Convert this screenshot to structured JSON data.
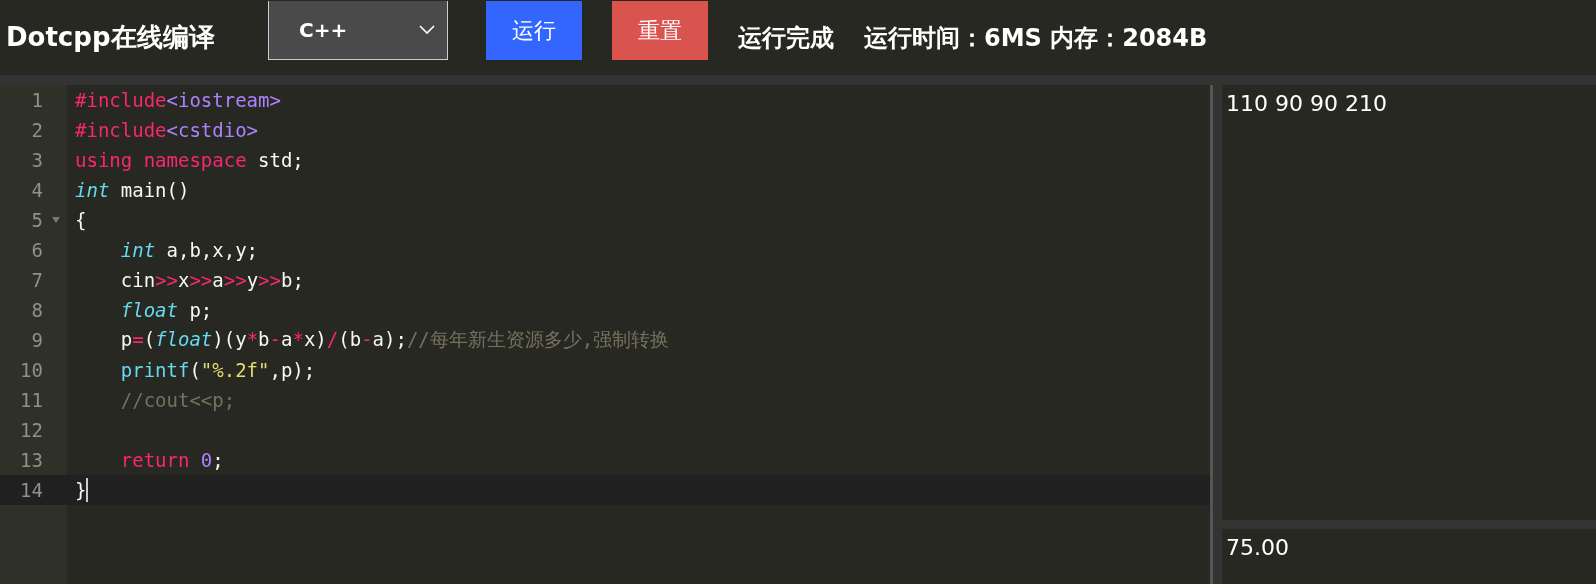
{
  "header": {
    "title": "Dotcpp在线编译",
    "language": "C++",
    "buttons": [
      {
        "kind": "run",
        "label": "运行"
      },
      {
        "kind": "reset",
        "label": "重置"
      }
    ],
    "status": "运行完成",
    "stats": "运行时间：6MS 内存：2084B"
  },
  "editor": {
    "lines": [
      {
        "number": "1",
        "active": false,
        "foldable": false,
        "tokens": [
          {
            "kind": "keyword",
            "text": "#include"
          },
          {
            "kind": "number",
            "text": "<iostream>"
          }
        ]
      },
      {
        "number": "2",
        "active": false,
        "foldable": false,
        "tokens": [
          {
            "kind": "keyword",
            "text": "#include"
          },
          {
            "kind": "number",
            "text": "<cstdio>"
          }
        ]
      },
      {
        "number": "3",
        "active": false,
        "foldable": false,
        "tokens": [
          {
            "kind": "keyword",
            "text": "using namespace"
          },
          {
            "kind": "plain",
            "text": " std;"
          }
        ]
      },
      {
        "number": "4",
        "active": false,
        "foldable": false,
        "tokens": [
          {
            "kind": "type",
            "text": "int"
          },
          {
            "kind": "plain",
            "text": " main()"
          }
        ]
      },
      {
        "number": "5",
        "active": false,
        "foldable": true,
        "tokens": [
          {
            "kind": "plain",
            "text": "{"
          }
        ]
      },
      {
        "number": "6",
        "active": false,
        "foldable": false,
        "tokens": [
          {
            "kind": "type",
            "text": "    int"
          },
          {
            "kind": "plain",
            "text": " a,b,x,y;"
          }
        ]
      },
      {
        "number": "7",
        "active": false,
        "foldable": false,
        "tokens": [
          {
            "kind": "plain",
            "text": "    cin"
          },
          {
            "kind": "keyword",
            "text": ">>"
          },
          {
            "kind": "plain",
            "text": "x"
          },
          {
            "kind": "keyword",
            "text": ">>"
          },
          {
            "kind": "plain",
            "text": "a"
          },
          {
            "kind": "keyword",
            "text": ">>"
          },
          {
            "kind": "plain",
            "text": "y"
          },
          {
            "kind": "keyword",
            "text": ">>"
          },
          {
            "kind": "plain",
            "text": "b;"
          }
        ]
      },
      {
        "number": "8",
        "active": false,
        "foldable": false,
        "tokens": [
          {
            "kind": "type",
            "text": "    float"
          },
          {
            "kind": "plain",
            "text": " p;"
          }
        ]
      },
      {
        "number": "9",
        "active": false,
        "foldable": false,
        "tokens": [
          {
            "kind": "plain",
            "text": "    p"
          },
          {
            "kind": "keyword",
            "text": "="
          },
          {
            "kind": "plain",
            "text": "("
          },
          {
            "kind": "type",
            "text": "float"
          },
          {
            "kind": "plain",
            "text": ")(y"
          },
          {
            "kind": "keyword",
            "text": "*"
          },
          {
            "kind": "plain",
            "text": "b"
          },
          {
            "kind": "keyword",
            "text": "-"
          },
          {
            "kind": "plain",
            "text": "a"
          },
          {
            "kind": "keyword",
            "text": "*"
          },
          {
            "kind": "plain",
            "text": "x)"
          },
          {
            "kind": "keyword",
            "text": "/"
          },
          {
            "kind": "plain",
            "text": "(b"
          },
          {
            "kind": "keyword",
            "text": "-"
          },
          {
            "kind": "plain",
            "text": "a);"
          },
          {
            "kind": "comment",
            "text": "//每年新生资源多少,强制转换"
          }
        ]
      },
      {
        "number": "10",
        "active": false,
        "foldable": false,
        "tokens": [
          {
            "kind": "func",
            "text": "    printf"
          },
          {
            "kind": "plain",
            "text": "("
          },
          {
            "kind": "string",
            "text": "\"%.2f\""
          },
          {
            "kind": "plain",
            "text": ",p);"
          }
        ]
      },
      {
        "number": "11",
        "active": false,
        "foldable": false,
        "tokens": [
          {
            "kind": "comment",
            "text": "    //cout<<p;"
          }
        ]
      },
      {
        "number": "12",
        "active": false,
        "foldable": false
      },
      {
        "number": "13",
        "active": false,
        "foldable": false,
        "tokens": [
          {
            "kind": "keyword",
            "text": "    return"
          },
          {
            "kind": "number",
            "text": " 0"
          },
          {
            "kind": "plain",
            "text": ";"
          }
        ]
      },
      {
        "number": "14",
        "active": true,
        "foldable": false,
        "tokens": [
          {
            "kind": "plain",
            "text": "}"
          }
        ]
      }
    ]
  },
  "input": "110 90 90 210",
  "output": "75.00"
}
